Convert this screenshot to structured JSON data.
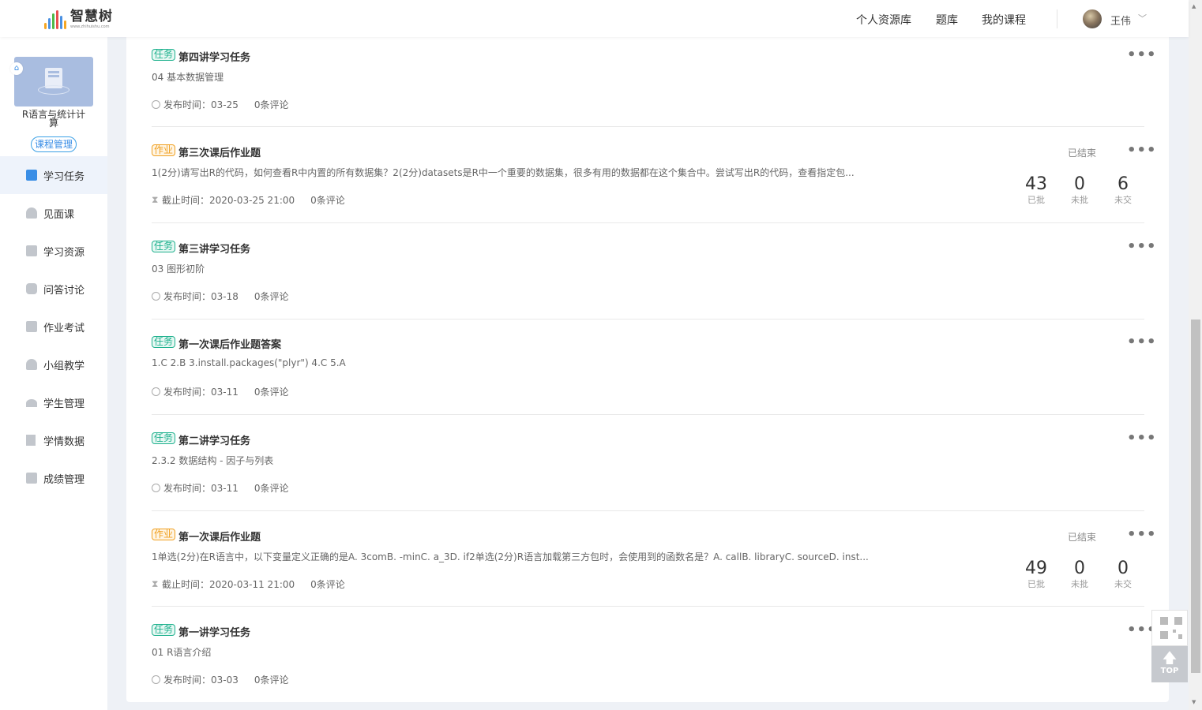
{
  "header": {
    "logo_text": "智慧树",
    "logo_url": "www.zhihuishu.com",
    "nav": [
      "个人资源库",
      "题库",
      "我的课程"
    ],
    "user_name": "王伟"
  },
  "sidebar": {
    "course_name": "R语言与统计计算",
    "course_manage": "课程管理",
    "items": [
      {
        "label": "学习任务",
        "icon": "task-icon",
        "active": true
      },
      {
        "label": "见面课",
        "icon": "person-icon"
      },
      {
        "label": "学习资源",
        "icon": "book-icon"
      },
      {
        "label": "问答讨论",
        "icon": "question-icon"
      },
      {
        "label": "作业考试",
        "icon": "exam-icon"
      },
      {
        "label": "小组教学",
        "icon": "group-icon"
      },
      {
        "label": "学生管理",
        "icon": "graduation-cap-icon"
      },
      {
        "label": "学情数据",
        "icon": "bar-chart-icon"
      },
      {
        "label": "成绩管理",
        "icon": "grade-icon"
      }
    ]
  },
  "tasks": [
    {
      "tag": "任务",
      "type": "task",
      "title": "第四讲学习任务",
      "desc": "04 基本数据管理",
      "meta_label": "发布时间：03-25",
      "comments": "0条评论"
    },
    {
      "tag": "作业",
      "type": "hw",
      "title": "第三次课后作业题",
      "desc": "1(2分)请写出R的代码，如何查看R中内置的所有数据集？2(2分)datasets是R中一个重要的数据集，很多有用的数据都在这个集合中。尝试写出R的代码，查看指定包...",
      "meta_label": "截止时间：2020-03-25 21:00",
      "comments": "0条评论",
      "status": "已结束",
      "stats": [
        {
          "num": "43",
          "label": "已批"
        },
        {
          "num": "0",
          "label": "未批"
        },
        {
          "num": "6",
          "label": "未交"
        }
      ]
    },
    {
      "tag": "任务",
      "type": "task",
      "title": "第三讲学习任务",
      "desc": "03 图形初阶",
      "meta_label": "发布时间：03-18",
      "comments": "0条评论"
    },
    {
      "tag": "任务",
      "type": "task",
      "title": "第一次课后作业题答案",
      "desc": "1.C  2.B  3.install.packages(\"plyr\")  4.C  5.A",
      "meta_label": "发布时间：03-11",
      "comments": "0条评论"
    },
    {
      "tag": "任务",
      "type": "task",
      "title": "第二讲学习任务",
      "desc": "2.3.2 数据结构 - 因子与列表",
      "meta_label": "发布时间：03-11",
      "comments": "0条评论"
    },
    {
      "tag": "作业",
      "type": "hw",
      "title": "第一次课后作业题",
      "desc": "1单选(2分)在R语言中，以下变量定义正确的是A. 3comB. -minC. a_3D. if2单选(2分)R语言加载第三方包时，会使用到的函数名是？A. callB. libraryC. sourceD. inst...",
      "meta_label": "截止时间：2020-03-11 21:00",
      "comments": "0条评论",
      "status": "已结束",
      "stats": [
        {
          "num": "49",
          "label": "已批"
        },
        {
          "num": "0",
          "label": "未批"
        },
        {
          "num": "0",
          "label": "未交"
        }
      ]
    },
    {
      "tag": "任务",
      "type": "task",
      "title": "第一讲学习任务",
      "desc": "01 R语言介绍",
      "meta_label": "发布时间：03-03",
      "comments": "0条评论"
    }
  ],
  "tools": {
    "top_label": "TOP"
  },
  "colors": {
    "accent": "#3a8ee6",
    "task_tag": "#1fb18e",
    "hw_tag": "#f0a020"
  }
}
